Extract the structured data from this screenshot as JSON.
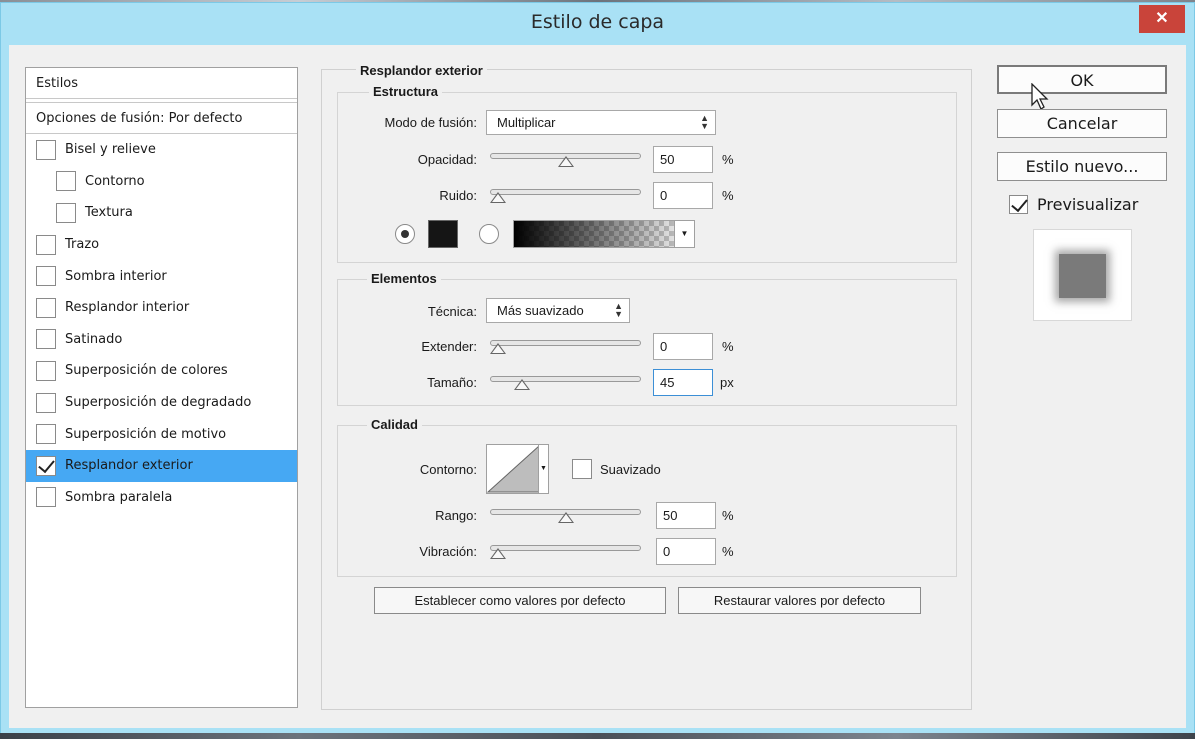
{
  "window": {
    "title": "Estilo de capa",
    "close_label": "✕"
  },
  "styles": {
    "header": "Estilos",
    "blend_options": "Opciones de fusión: Por defecto",
    "items": [
      {
        "label": "Bisel y relieve",
        "checked": false
      },
      {
        "label": "Contorno",
        "checked": false
      },
      {
        "label": "Textura",
        "checked": false
      },
      {
        "label": "Trazo",
        "checked": false
      },
      {
        "label": "Sombra interior",
        "checked": false
      },
      {
        "label": "Resplandor interior",
        "checked": false
      },
      {
        "label": "Satinado",
        "checked": false
      },
      {
        "label": "Superposición de colores",
        "checked": false
      },
      {
        "label": "Superposición de degradado",
        "checked": false
      },
      {
        "label": "Superposición de motivo",
        "checked": false
      },
      {
        "label": "Resplandor exterior",
        "checked": true
      },
      {
        "label": "Sombra paralela",
        "checked": false
      }
    ]
  },
  "outer_glow": {
    "title": "Resplandor exterior",
    "structure": {
      "title": "Estructura",
      "blend_mode_label": "Modo de fusión:",
      "blend_mode_value": "Multiplicar",
      "opacity_label": "Opacidad:",
      "opacity_value": "50",
      "opacity_unit": "%",
      "opacity_level": 0.5,
      "noise_label": "Ruido:",
      "noise_value": "0",
      "noise_unit": "%",
      "noise_level": 0,
      "color": "#151515"
    },
    "elements": {
      "title": "Elementos",
      "technique_label": "Técnica:",
      "technique_value": "Más suavizado",
      "spread_label": "Extender:",
      "spread_value": "0",
      "spread_unit": "%",
      "spread_level": 0,
      "size_label": "Tamaño:",
      "size_value": "45",
      "size_unit": "px",
      "size_level": 0.18
    },
    "quality": {
      "title": "Calidad",
      "contour_label": "Contorno:",
      "antialias_label": "Suavizado",
      "range_label": "Rango:",
      "range_value": "50",
      "range_unit": "%",
      "range_level": 0.5,
      "jitter_label": "Vibración:",
      "jitter_value": "0",
      "jitter_unit": "%",
      "jitter_level": 0
    },
    "set_default_label": "Establecer como valores por defecto",
    "reset_default_label": "Restaurar valores por defecto"
  },
  "actions": {
    "ok_label": "OK",
    "cancel_label": "Cancelar",
    "new_style_label": "Estilo nuevo...",
    "preview_label": "Previsualizar",
    "preview_checked": true
  }
}
